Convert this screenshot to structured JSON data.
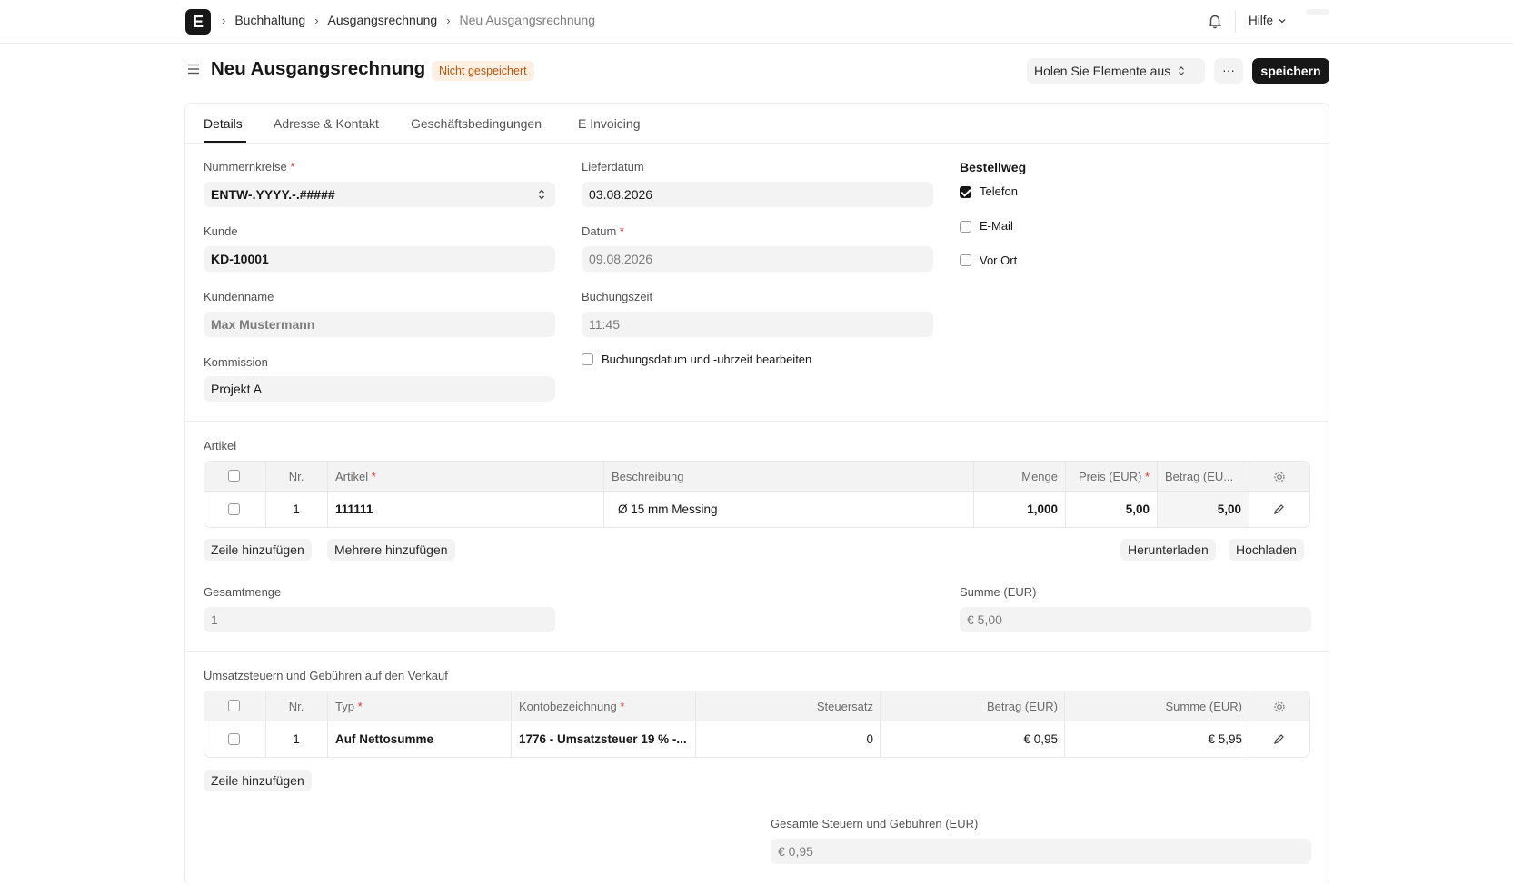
{
  "navbar": {
    "logo_letter": "E",
    "breadcrumbs": [
      "Buchhaltung",
      "Ausgangsrechnung",
      "Neu Ausgangsrechnung"
    ],
    "help_label": "Hilfe"
  },
  "header": {
    "title": "Neu Ausgangsrechnung",
    "status": "Nicht gespeichert",
    "get_items_label": "Holen Sie Elemente aus",
    "more_label": "···",
    "save_label": "speichern"
  },
  "tabs": [
    "Details",
    "Adresse & Kontakt",
    "Geschäftsbedingungen",
    "E Invoicing"
  ],
  "details": {
    "naming_series": {
      "label": "Nummernkreise",
      "value": "ENTW-.YYYY.-.#####",
      "required": "*"
    },
    "customer": {
      "label": "Kunde",
      "value": "KD-10001"
    },
    "customer_name": {
      "label": "Kundenname",
      "value": "Max Mustermann"
    },
    "commission": {
      "label": "Kommission",
      "value": "Projekt A"
    },
    "delivery_date": {
      "label": "Lieferdatum",
      "value": "03.08.2026"
    },
    "date": {
      "label": "Datum",
      "value": "09.08.2026",
      "required": "*"
    },
    "posting_time": {
      "label": "Buchungszeit",
      "value": "11:45"
    },
    "edit_posting": {
      "label": "Buchungsdatum und -uhrzeit bearbeiten",
      "checked": false
    },
    "order_channel": {
      "title": "Bestellweg",
      "options": [
        {
          "label": "Telefon",
          "checked": true
        },
        {
          "label": "E-Mail",
          "checked": false
        },
        {
          "label": "Vor Ort",
          "checked": false
        }
      ]
    }
  },
  "items": {
    "section_label": "Artikel",
    "headers": {
      "no": "Nr.",
      "item": "Artikel",
      "description": "Beschreibung",
      "qty": "Menge",
      "rate": "Preis (EUR)",
      "amount": "Betrag (EU...",
      "required": "*"
    },
    "rows": [
      {
        "no": "1",
        "item": "111111",
        "description": "Ø 15 mm Messing",
        "qty": "1,000",
        "rate": "5,00",
        "amount": "5,00"
      }
    ],
    "add_row_label": "Zeile hinzufügen",
    "add_multiple_label": "Mehrere hinzufügen",
    "download_label": "Herunterladen",
    "upload_label": "Hochladen"
  },
  "totals": {
    "total_qty": {
      "label": "Gesamtmenge",
      "value": "1"
    },
    "total": {
      "label": "Summe (EUR)",
      "value": "€ 5,00"
    }
  },
  "taxes": {
    "section_label": "Umsatzsteuern und Gebühren auf den Verkauf",
    "headers": {
      "no": "Nr.",
      "type": "Typ",
      "account": "Kontobezeichnung",
      "rate": "Steuersatz",
      "amount": "Betrag (EUR)",
      "total": "Summe (EUR)",
      "required": "*"
    },
    "rows": [
      {
        "no": "1",
        "type": "Auf Nettosumme",
        "account": "1776 - Umsatzsteuer 19 % -...",
        "rate": "0",
        "amount": "€ 0,95",
        "total": "€ 5,95"
      }
    ],
    "add_row_label": "Zeile hinzufügen",
    "total_taxes": {
      "label": "Gesamte Steuern und Gebühren (EUR)",
      "value": "€ 0,95"
    }
  }
}
